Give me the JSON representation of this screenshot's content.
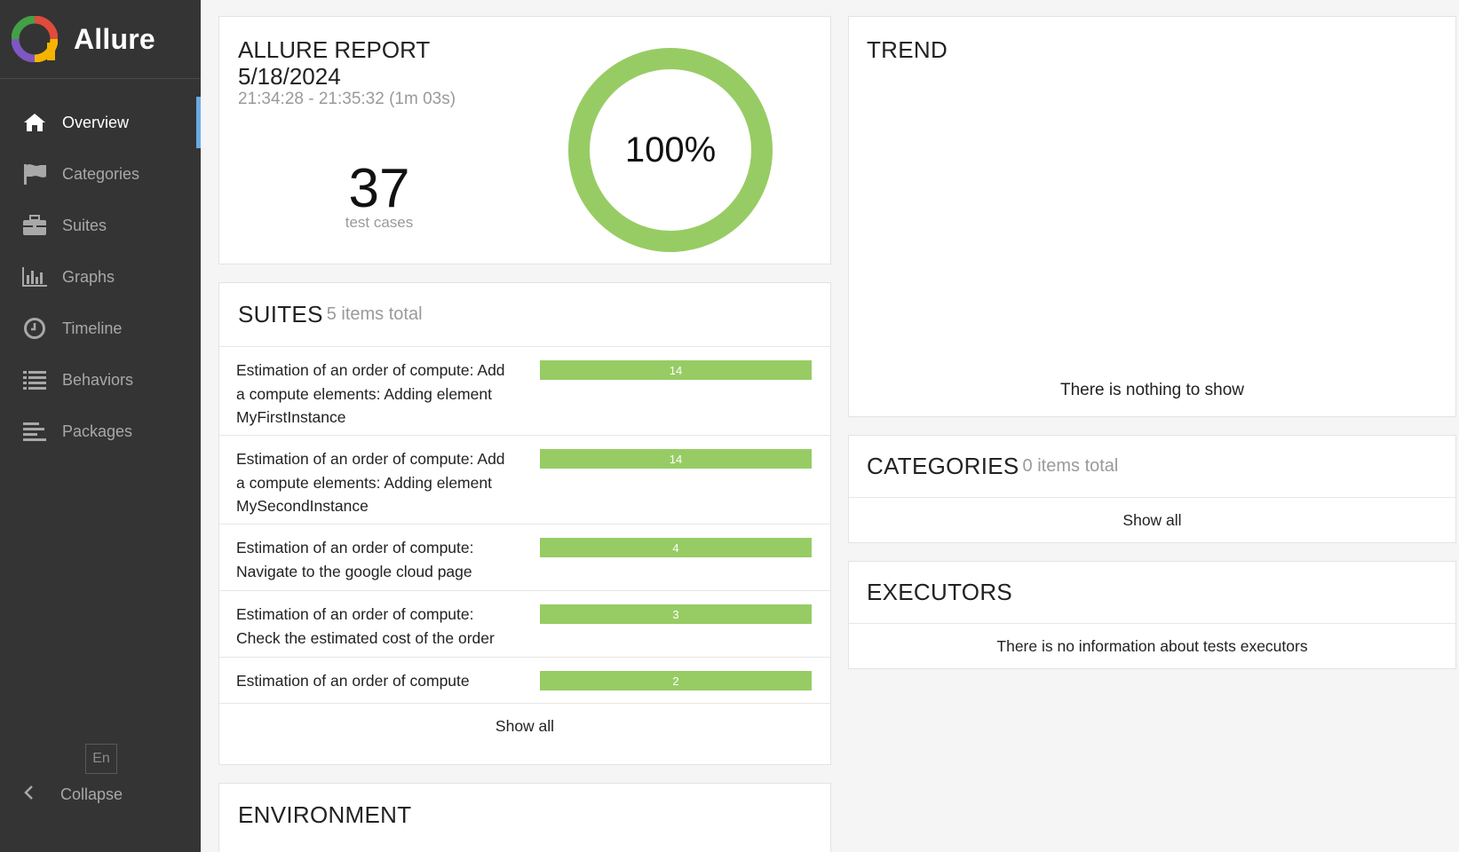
{
  "app": {
    "name": "Allure"
  },
  "sidebar": {
    "items": [
      {
        "label": "Overview",
        "icon": "home-icon",
        "active": true
      },
      {
        "label": "Categories",
        "icon": "flag-icon",
        "active": false
      },
      {
        "label": "Suites",
        "icon": "briefcase-icon",
        "active": false
      },
      {
        "label": "Graphs",
        "icon": "bar-chart-icon",
        "active": false
      },
      {
        "label": "Timeline",
        "icon": "clock-icon",
        "active": false
      },
      {
        "label": "Behaviors",
        "icon": "list-icon",
        "active": false
      },
      {
        "label": "Packages",
        "icon": "align-left-icon",
        "active": false
      }
    ],
    "language": "En",
    "collapse_label": "Collapse"
  },
  "summary": {
    "title": "ALLURE REPORT",
    "date": "5/18/2024",
    "time_range": "21:34:28 - 21:35:32 (1m 03s)",
    "test_count": "37",
    "test_count_label": "test cases",
    "pass_percent": "100%",
    "pass_fraction": 1.0
  },
  "suites": {
    "title": "SUITES",
    "subtitle": "5 items total",
    "items": [
      {
        "name": "Estimation of an order of compute: Add a compute elements: Adding element MyFirstInstance",
        "count": "14"
      },
      {
        "name": "Estimation of an order of compute: Add a compute elements: Adding element MySecondInstance",
        "count": "14"
      },
      {
        "name": "Estimation of an order of compute: Navigate to the google cloud page",
        "count": "4"
      },
      {
        "name": "Estimation of an order of compute: Check the estimated cost of the order",
        "count": "3"
      },
      {
        "name": "Estimation of an order of compute",
        "count": "2"
      }
    ],
    "show_all_label": "Show all"
  },
  "environment": {
    "title": "ENVIRONMENT"
  },
  "trend": {
    "title": "TREND",
    "empty_text": "There is nothing to show"
  },
  "categories": {
    "title": "CATEGORIES",
    "subtitle": "0 items total",
    "show_all_label": "Show all"
  },
  "executors": {
    "title": "EXECUTORS",
    "empty_text": "There is no information about tests executors"
  },
  "colors": {
    "passed": "#97cc64",
    "sidebar_bg": "#343434",
    "active_indicator": "#6aabe4"
  }
}
